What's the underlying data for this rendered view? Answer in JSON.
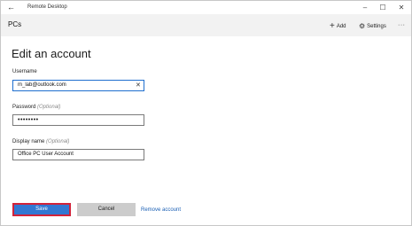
{
  "window": {
    "title": "Remote Desktop",
    "back_glyph": "←",
    "minimize_glyph": "–",
    "maximize_glyph": "☐",
    "close_glyph": "✕"
  },
  "commandbar": {
    "section": "PCs",
    "add_label": "Add",
    "add_glyph": "+",
    "settings_label": "Settings",
    "settings_glyph": "⚙",
    "more_glyph": "···"
  },
  "form": {
    "heading": "Edit an account",
    "username": {
      "label": "Username",
      "value": "m_lab@outlook.com",
      "clear_glyph": "✕"
    },
    "password": {
      "label": "Password",
      "optional": "(Optional)",
      "value": "••••••••"
    },
    "display_name": {
      "label": "Display name",
      "optional": "(Optional)",
      "value": "Office PC User Account"
    }
  },
  "actions": {
    "save_label": "Save",
    "cancel_label": "Cancel",
    "remove_label": "Remove account"
  },
  "colors": {
    "accent": "#3277d2",
    "focus_outline": "#d2233a",
    "link": "#1a5fb4"
  },
  "icons": [
    "back-arrow-icon",
    "minimize-icon",
    "maximize-icon",
    "close-icon",
    "plus-icon",
    "gear-icon",
    "more-icon",
    "clear-icon"
  ]
}
